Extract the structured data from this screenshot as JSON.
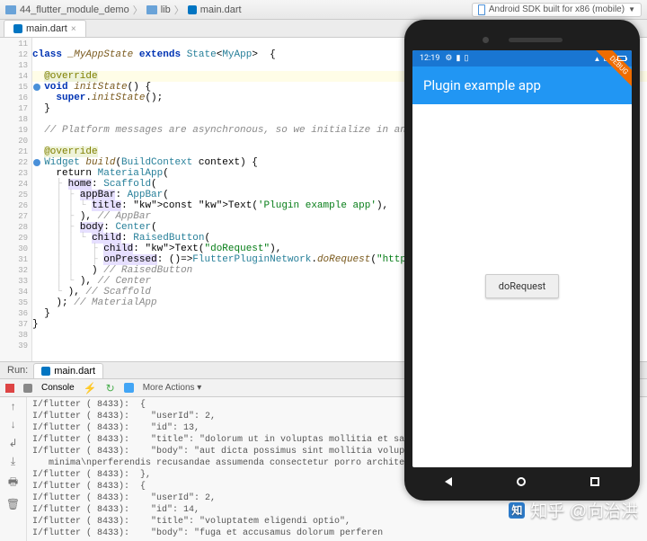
{
  "breadcrumb": {
    "project": "44_flutter_module_demo",
    "folder": "lib",
    "file": "main.dart"
  },
  "device_dropdown": "Android SDK built for x86 (mobile)",
  "editor_tab": "main.dart",
  "gutter": {
    "start": 11,
    "end": 39,
    "breakpoints": [
      15,
      22
    ]
  },
  "code": [
    {
      "i": 11,
      "t": ""
    },
    {
      "i": 12,
      "t": "class _MyAppState extends State<MyApp>  {",
      "k": true
    },
    {
      "i": 13,
      "t": ""
    },
    {
      "i": 14,
      "t": "  @override",
      "hl": true,
      "an": true
    },
    {
      "i": 15,
      "t": "  void initState() {",
      "k": true
    },
    {
      "i": 16,
      "t": "    super.initState();"
    },
    {
      "i": 17,
      "t": "  }"
    },
    {
      "i": 18,
      "t": ""
    },
    {
      "i": 19,
      "t": "  // Platform messages are asynchronous, so we initialize in an async method.",
      "cm": true
    },
    {
      "i": 20,
      "t": ""
    },
    {
      "i": 21,
      "t": "  @override",
      "an": true
    },
    {
      "i": 22,
      "t": "  Widget build(BuildContext context) {",
      "k": true
    },
    {
      "i": 23,
      "t": "    return MaterialApp(",
      "cls": "MaterialApp"
    },
    {
      "i": 24,
      "t": "    ├ home: Scaffold(",
      "cls": "Scaffold"
    },
    {
      "i": 25,
      "t": "    │ ├ appBar: AppBar(",
      "cls": "AppBar"
    },
    {
      "i": 26,
      "t": "    │ │ └ title: const Text('Plugin example app'),",
      "str": true
    },
    {
      "i": 27,
      "t": "    │ ├ ), // AppBar",
      "cm2": true
    },
    {
      "i": 28,
      "t": "    │ ├ body: Center(",
      "cls": "Center"
    },
    {
      "i": 29,
      "t": "    │ │ └ child: RaisedButton(",
      "cls": "RaisedButton"
    },
    {
      "i": 30,
      "t": "    │ │   ├ child: Text(\"doRequest\"),",
      "str": true
    },
    {
      "i": 31,
      "t": "    │ │   ├ onPressed: ()=>FlutterPluginNetwork.doRequest(\"https://jsonplaceho",
      "fn": true
    },
    {
      "i": 32,
      "t": "    │ │   ) // RaisedButton",
      "cm2": true
    },
    {
      "i": 33,
      "t": "    │ └ ), // Center",
      "cm2": true
    },
    {
      "i": 34,
      "t": "    └ ), // Scaffold",
      "cm2": true
    },
    {
      "i": 35,
      "t": "    ); // MaterialApp",
      "cm2": true
    },
    {
      "i": 36,
      "t": "  }"
    },
    {
      "i": 37,
      "t": "}"
    },
    {
      "i": 38,
      "t": ""
    },
    {
      "i": 39,
      "t": ""
    }
  ],
  "run": {
    "label": "Run:",
    "tab": "main.dart"
  },
  "toolrow": {
    "console_label": "Console",
    "more_actions": "More Actions"
  },
  "console_lines": [
    "I/flutter ( 8433):  {",
    "I/flutter ( 8433):    \"userId\": 2,",
    "I/flutter ( 8433):    \"id\": 13,",
    "I/flutter ( 8433):    \"title\": \"dolorum ut in voluptas mollitia et saepe quo an",
    "I/flutter ( 8433):    \"body\": \"aut dicta possimus sint mollitia voluptas commod",
    "   minima\\nperferendis recusandae assumenda consectetur porro architecto ipsum ip",
    "I/flutter ( 8433):  },",
    "I/flutter ( 8433):  {",
    "I/flutter ( 8433):    \"userId\": 2,",
    "I/flutter ( 8433):    \"id\": 14,",
    "I/flutter ( 8433):    \"title\": \"voluptatem eligendi optio\",",
    "I/flutter ( 8433):    \"body\": \"fuga et accusamus dolorum perferen"
  ],
  "phone": {
    "time": "12:19",
    "status_right": "LTE",
    "sig_icon": "▲",
    "debug_label": "DEBUG",
    "app_title": "Plugin example app",
    "button_label": "doRequest"
  },
  "watermark": {
    "logo": "知",
    "text": "知乎 @向治洪"
  }
}
